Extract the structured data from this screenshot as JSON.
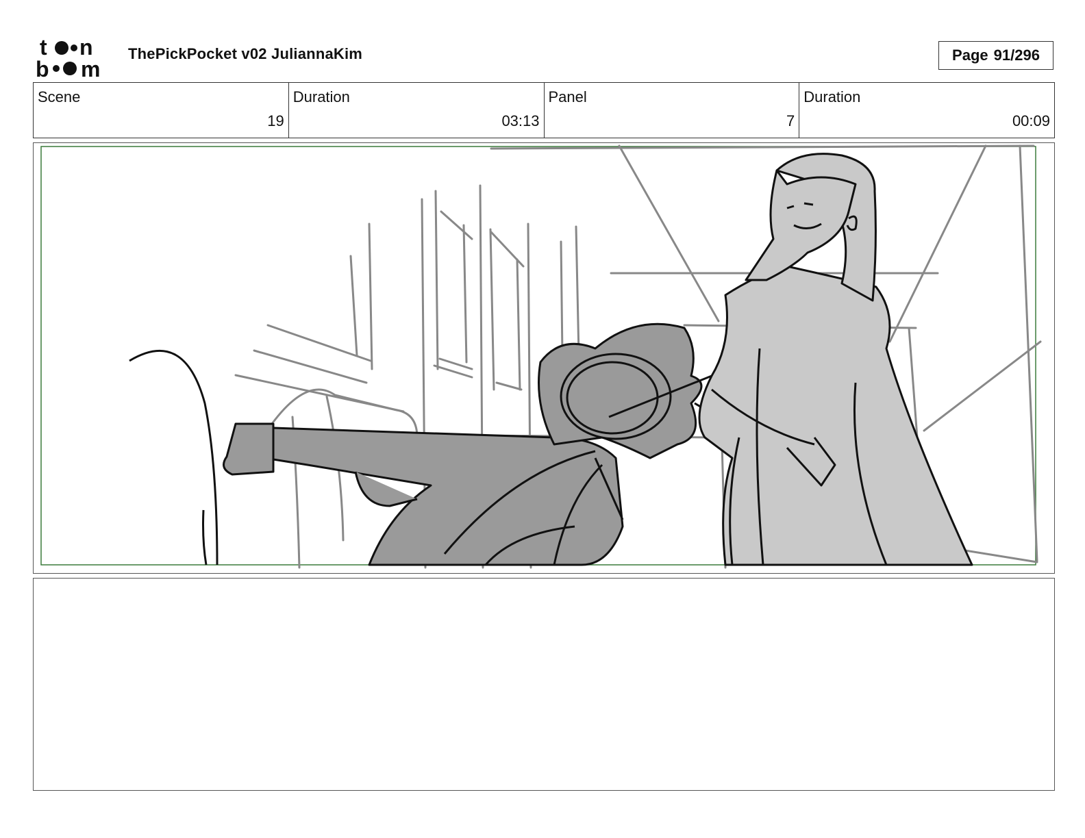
{
  "header": {
    "logo_text": "toon boom",
    "title": "ThePickPocket v02 JuliannaKim",
    "page_label": "Page",
    "page_value": "91/296"
  },
  "info": {
    "scene_label": "Scene",
    "scene_value": "19",
    "scene_duration_label": "Duration",
    "scene_duration_value": "03:13",
    "panel_label": "Panel",
    "panel_value": "7",
    "panel_duration_label": "Duration",
    "panel_duration_value": "00:09"
  },
  "colors": {
    "safe_frame": "#3a7a3a",
    "sketch_line": "#111111",
    "background_line": "#888888",
    "fill_dark": "#9a9a9a",
    "fill_light": "#c9c9c9"
  }
}
